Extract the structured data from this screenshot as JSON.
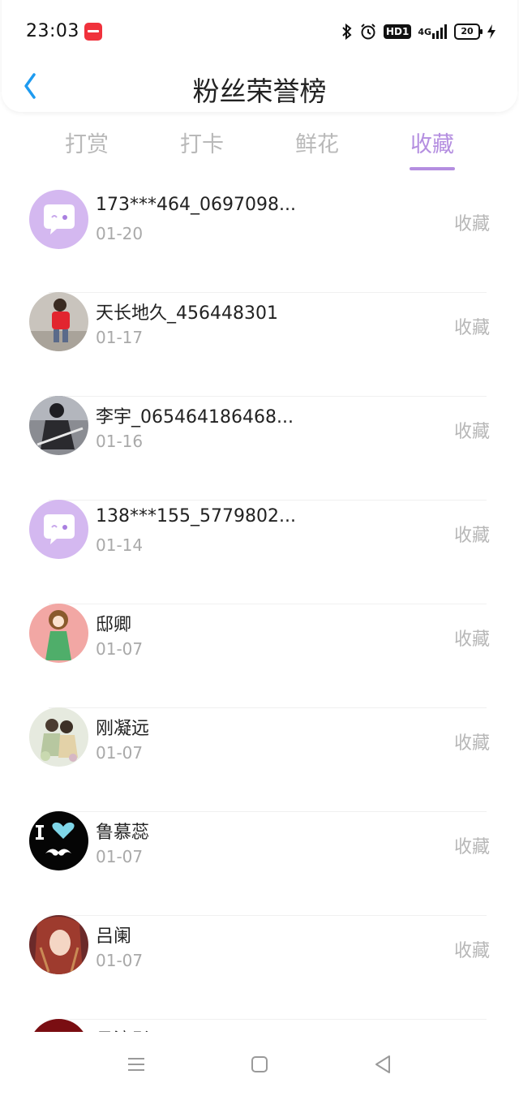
{
  "status_bar": {
    "time": "23:03",
    "hd": "HD1",
    "network": "4G",
    "battery": "20"
  },
  "header": {
    "title": "粉丝荣誉榜"
  },
  "tabs": [
    {
      "label": "打赏"
    },
    {
      "label": "打卡"
    },
    {
      "label": "鲜花"
    },
    {
      "label": "收藏",
      "active": true
    }
  ],
  "fans": [
    {
      "name": "173***464_0697098...",
      "date": "01-20",
      "action": "收藏",
      "avatar": "default-chat-avatar"
    },
    {
      "name": "天长地久_456448301",
      "date": "01-17",
      "action": "收藏",
      "avatar": "photo-child-red-shirt"
    },
    {
      "name": "李宇_065464186468...",
      "date": "01-16",
      "action": "收藏",
      "avatar": "photo-person-dark"
    },
    {
      "name": "138***155_5779802...",
      "date": "01-14",
      "action": "收藏",
      "avatar": "default-chat-avatar"
    },
    {
      "name": "邸卿",
      "date": "01-07",
      "action": "收藏",
      "avatar": "illustration-girl-pink"
    },
    {
      "name": "刚凝远",
      "date": "01-07",
      "action": "收藏",
      "avatar": "illustration-couple-flowers"
    },
    {
      "name": "鲁慕蕊",
      "date": "01-07",
      "action": "收藏",
      "avatar": "i-love-mustache"
    },
    {
      "name": "吕阑",
      "date": "01-07",
      "action": "收藏",
      "avatar": "illustration-woman-redhair"
    },
    {
      "name": "吕流彤",
      "date": "",
      "action": "",
      "avatar": "dark-red-avatar"
    }
  ],
  "colors": {
    "accent": "#b48ee0",
    "back_arrow": "#1e9bf0",
    "inactive_tab": "#b9b9b9"
  }
}
